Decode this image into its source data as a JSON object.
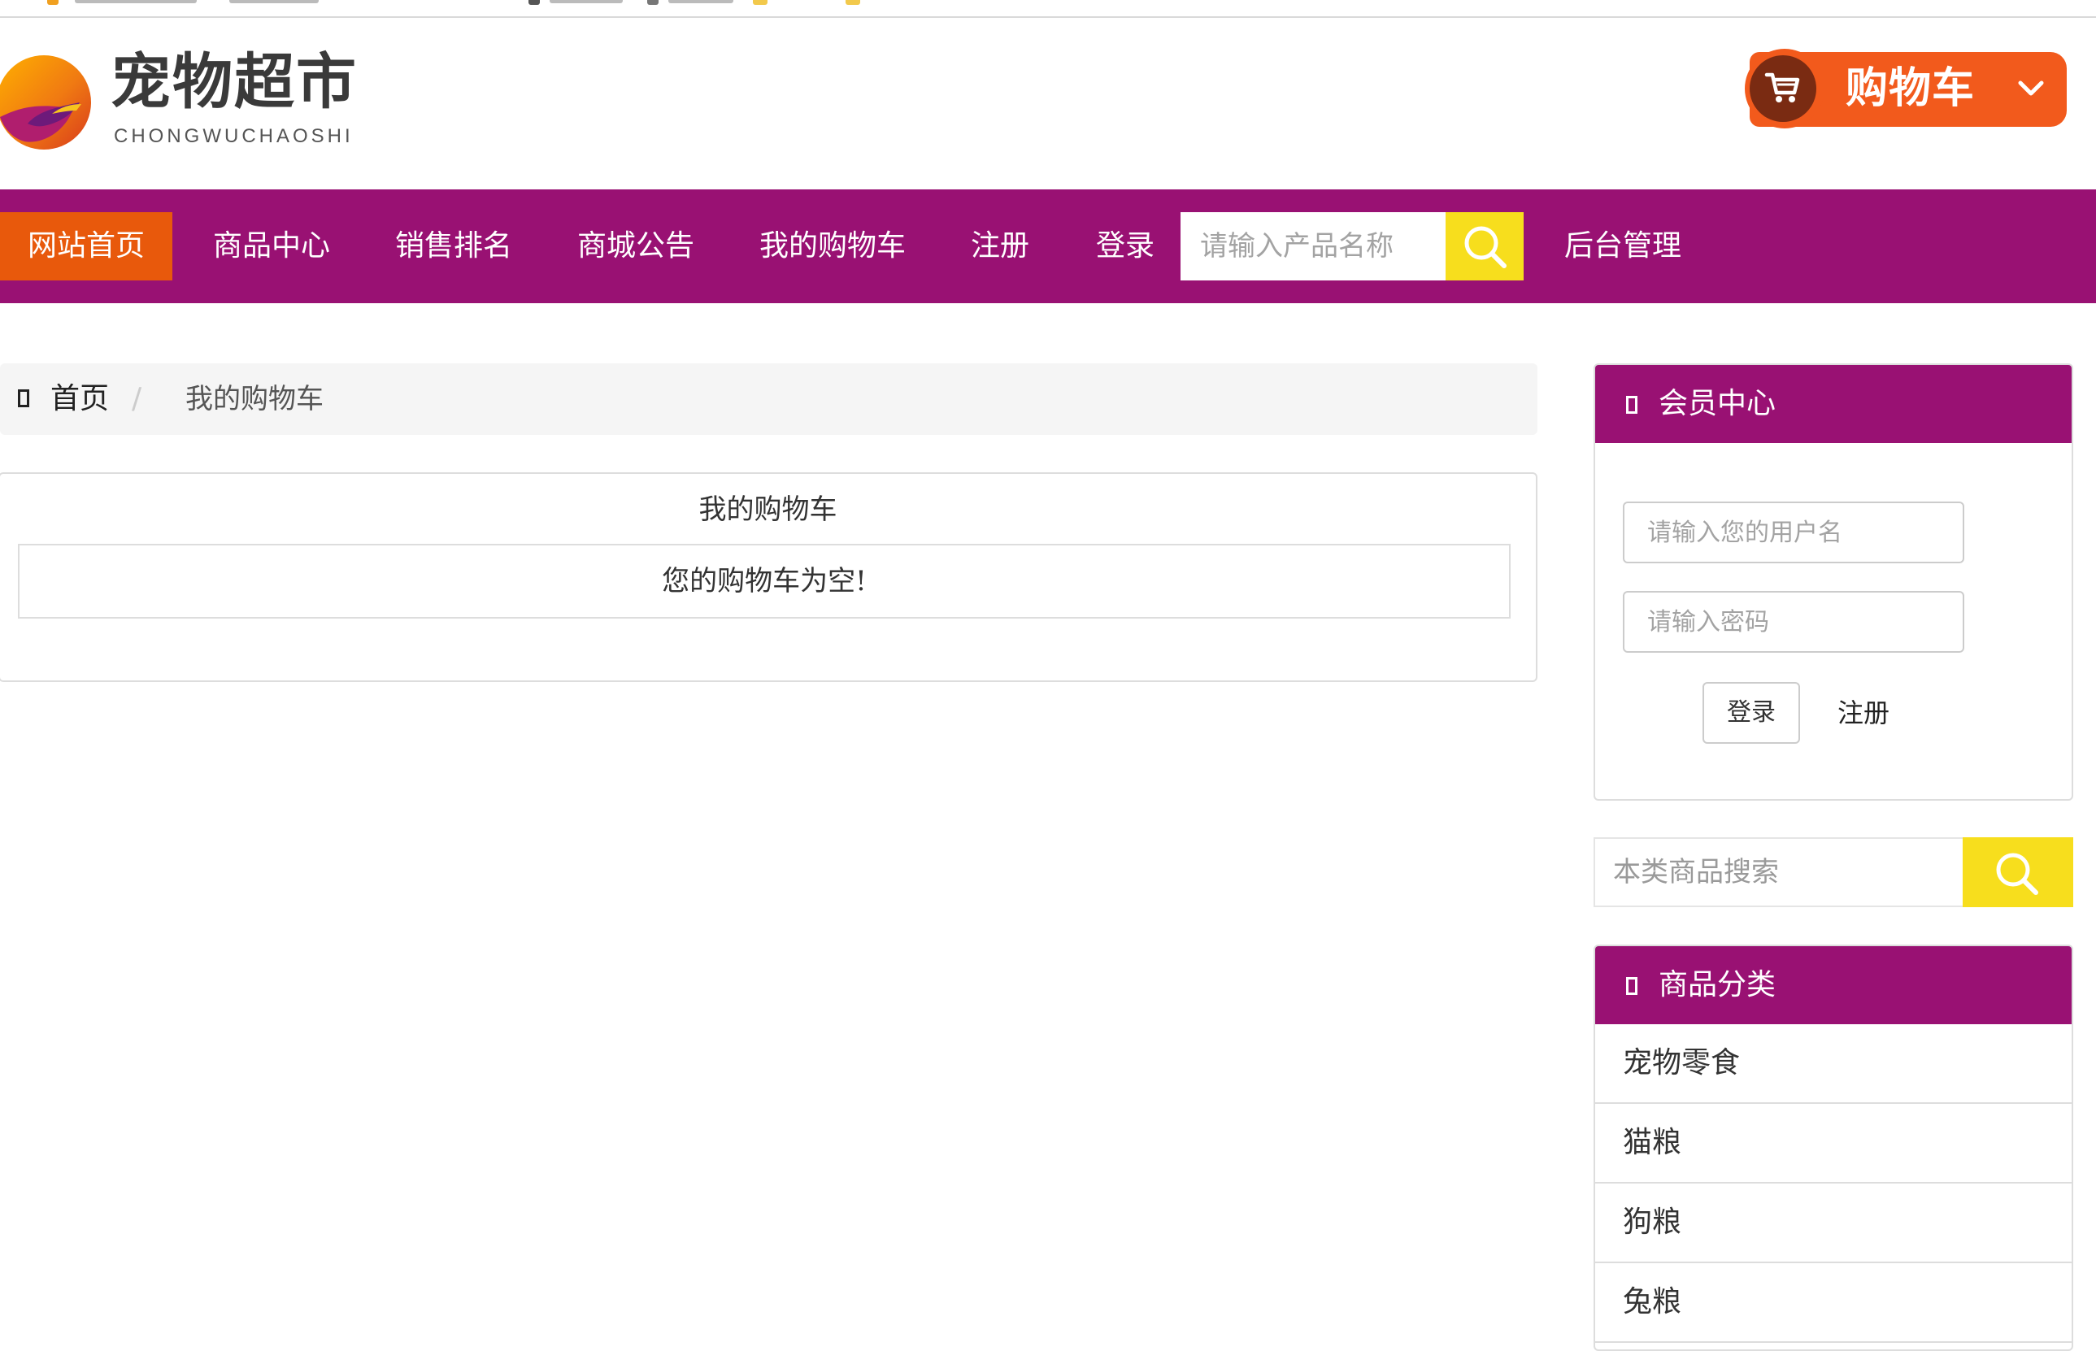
{
  "site": {
    "logo_title": "宠物超市",
    "logo_pinyin": "CHONGWUCHAOSHI",
    "brand_colors": {
      "nav": "#991173",
      "active": "#e8590c",
      "cart": "#f25a1c",
      "search_button": "#f7de1d"
    }
  },
  "header": {
    "cart_button": {
      "label": "购物车",
      "icon": "shopping-cart-icon",
      "dropdown_icon": "chevron-down-icon"
    }
  },
  "nav": {
    "items": [
      {
        "label": "网站首页",
        "active": true
      },
      {
        "label": "商品中心"
      },
      {
        "label": "销售排名"
      },
      {
        "label": "商城公告"
      },
      {
        "label": "我的购物车"
      },
      {
        "label": "注册"
      },
      {
        "label": "登录"
      }
    ],
    "search": {
      "placeholder": "请输入产品名称",
      "value": "",
      "icon": "search-icon"
    },
    "admin_label": "后台管理"
  },
  "breadcrumb": {
    "home": "首页",
    "separator": "/",
    "current": "我的购物车"
  },
  "cart": {
    "title": "我的购物车",
    "empty_message": "您的购物车为空!"
  },
  "sidebar": {
    "member": {
      "title": "会员中心",
      "username_placeholder": "请输入您的用户名",
      "password_placeholder": "请输入密码",
      "login_label": "登录",
      "register_label": "注册"
    },
    "search": {
      "placeholder": "本类商品搜索",
      "value": "",
      "icon": "search-icon"
    },
    "categories": {
      "title": "商品分类",
      "items": [
        "宠物零食",
        "猫粮",
        "狗粮",
        "兔粮"
      ]
    }
  }
}
